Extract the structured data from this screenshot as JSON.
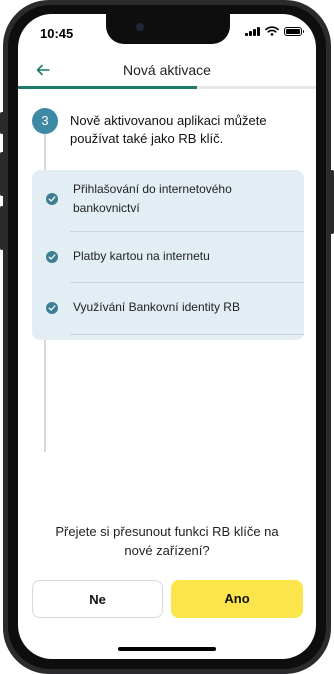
{
  "status": {
    "time": "10:45"
  },
  "header": {
    "title": "Nová aktivace",
    "back_icon": "arrow-left-icon"
  },
  "progress": {
    "fraction": 0.6
  },
  "step": {
    "number": "3",
    "text": "Nově aktivovanou aplikaci můžete používat také jako RB klíč."
  },
  "features": [
    {
      "label": "Přihlašování do internetového bankovnictví"
    },
    {
      "label": "Platby kartou na internetu"
    },
    {
      "label": "Využívání Bankovní identity RB"
    }
  ],
  "question": "Přejete si přesunout funkci RB klíče na nové zařízení?",
  "buttons": {
    "no": "Ne",
    "yes": "Ano"
  },
  "colors": {
    "accent": "#1f7a6a",
    "step": "#3e8aa6",
    "panel": "#e2eef4",
    "yes": "#fbe54b"
  }
}
